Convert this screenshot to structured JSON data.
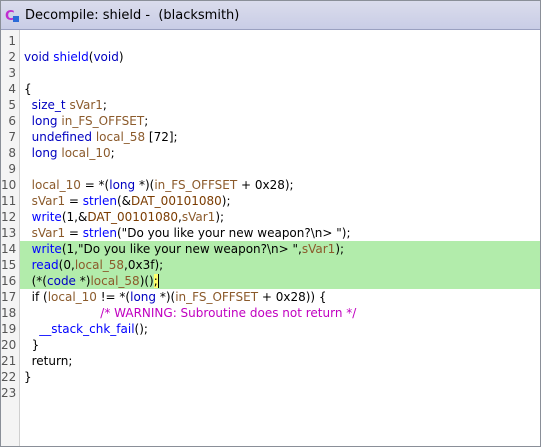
{
  "window": {
    "title": "Decompile: shield -  (blacksmith)",
    "icon": "decompiler-icon",
    "colors": {
      "highlight": "#b2ecab",
      "type": "#0000c0",
      "function": "#0000ff",
      "variable": "#8b5a2b",
      "comment": "#c000c0"
    }
  },
  "code": {
    "lines": [
      {
        "n": "1",
        "hl": false,
        "tokens": []
      },
      {
        "n": "2",
        "hl": false,
        "tokens": [
          {
            "t": "void ",
            "c": "type"
          },
          {
            "t": "shield",
            "c": "func"
          },
          {
            "t": "(",
            "c": "plain"
          },
          {
            "t": "void",
            "c": "type"
          },
          {
            "t": ")",
            "c": "plain"
          }
        ]
      },
      {
        "n": "3",
        "hl": false,
        "tokens": []
      },
      {
        "n": "4",
        "hl": false,
        "tokens": [
          {
            "t": "{",
            "c": "plain"
          }
        ]
      },
      {
        "n": "5",
        "hl": false,
        "tokens": [
          {
            "t": "  ",
            "c": "plain"
          },
          {
            "t": "size_t",
            "c": "type"
          },
          {
            "t": " ",
            "c": "plain"
          },
          {
            "t": "sVar1",
            "c": "var"
          },
          {
            "t": ";",
            "c": "plain"
          }
        ]
      },
      {
        "n": "6",
        "hl": false,
        "tokens": [
          {
            "t": "  ",
            "c": "plain"
          },
          {
            "t": "long",
            "c": "type"
          },
          {
            "t": " ",
            "c": "plain"
          },
          {
            "t": "in_FS_OFFSET",
            "c": "var"
          },
          {
            "t": ";",
            "c": "plain"
          }
        ]
      },
      {
        "n": "7",
        "hl": false,
        "tokens": [
          {
            "t": "  ",
            "c": "plain"
          },
          {
            "t": "undefined",
            "c": "type"
          },
          {
            "t": " ",
            "c": "plain"
          },
          {
            "t": "local_58",
            "c": "var"
          },
          {
            "t": " [72];",
            "c": "plain"
          }
        ]
      },
      {
        "n": "8",
        "hl": false,
        "tokens": [
          {
            "t": "  ",
            "c": "plain"
          },
          {
            "t": "long",
            "c": "type"
          },
          {
            "t": " ",
            "c": "plain"
          },
          {
            "t": "local_10",
            "c": "var"
          },
          {
            "t": ";",
            "c": "plain"
          }
        ]
      },
      {
        "n": "9",
        "hl": false,
        "tokens": []
      },
      {
        "n": "10",
        "hl": false,
        "tokens": [
          {
            "t": "  ",
            "c": "plain"
          },
          {
            "t": "local_10",
            "c": "var"
          },
          {
            "t": " = *(",
            "c": "plain"
          },
          {
            "t": "long",
            "c": "type"
          },
          {
            "t": " *)(",
            "c": "plain"
          },
          {
            "t": "in_FS_OFFSET",
            "c": "var"
          },
          {
            "t": " + 0x28);",
            "c": "plain"
          }
        ]
      },
      {
        "n": "11",
        "hl": false,
        "tokens": [
          {
            "t": "  ",
            "c": "plain"
          },
          {
            "t": "sVar1",
            "c": "var"
          },
          {
            "t": " = ",
            "c": "plain"
          },
          {
            "t": "strlen",
            "c": "func"
          },
          {
            "t": "(&",
            "c": "plain"
          },
          {
            "t": "DAT_00101080",
            "c": "glob"
          },
          {
            "t": ");",
            "c": "plain"
          }
        ]
      },
      {
        "n": "12",
        "hl": false,
        "tokens": [
          {
            "t": "  ",
            "c": "plain"
          },
          {
            "t": "write",
            "c": "func"
          },
          {
            "t": "(1,&",
            "c": "plain"
          },
          {
            "t": "DAT_00101080",
            "c": "glob"
          },
          {
            "t": ",",
            "c": "plain"
          },
          {
            "t": "sVar1",
            "c": "var"
          },
          {
            "t": ");",
            "c": "plain"
          }
        ]
      },
      {
        "n": "13",
        "hl": false,
        "tokens": [
          {
            "t": "  ",
            "c": "plain"
          },
          {
            "t": "sVar1",
            "c": "var"
          },
          {
            "t": " = ",
            "c": "plain"
          },
          {
            "t": "strlen",
            "c": "func"
          },
          {
            "t": "(\"Do you like your new weapon?\\n> \");",
            "c": "plain"
          }
        ]
      },
      {
        "n": "14",
        "hl": true,
        "tokens": [
          {
            "t": "  ",
            "c": "plain"
          },
          {
            "t": "write",
            "c": "func"
          },
          {
            "t": "(1,\"Do you like your new weapon?\\n> \",",
            "c": "plain"
          },
          {
            "t": "sVar1",
            "c": "var"
          },
          {
            "t": ");",
            "c": "plain"
          }
        ]
      },
      {
        "n": "15",
        "hl": true,
        "tokens": [
          {
            "t": "  ",
            "c": "plain"
          },
          {
            "t": "read",
            "c": "func"
          },
          {
            "t": "(0,",
            "c": "plain"
          },
          {
            "t": "local_58",
            "c": "var"
          },
          {
            "t": ",0x3f);",
            "c": "plain"
          }
        ]
      },
      {
        "n": "16",
        "hl": true,
        "tokens": [
          {
            "t": "  (*(",
            "c": "plain"
          },
          {
            "t": "code",
            "c": "type"
          },
          {
            "t": " *)",
            "c": "plain"
          },
          {
            "t": "local_58",
            "c": "var"
          },
          {
            "t": ")()",
            "c": "plain"
          },
          {
            "t": ";",
            "c": "cursor"
          }
        ]
      },
      {
        "n": "17",
        "hl": false,
        "tokens": [
          {
            "t": "  if (",
            "c": "plain"
          },
          {
            "t": "local_10",
            "c": "var"
          },
          {
            "t": " != *(",
            "c": "plain"
          },
          {
            "t": "long",
            "c": "type"
          },
          {
            "t": " *)(",
            "c": "plain"
          },
          {
            "t": "in_FS_OFFSET",
            "c": "var"
          },
          {
            "t": " + 0x28)) {",
            "c": "plain"
          }
        ]
      },
      {
        "n": "18",
        "hl": false,
        "tokens": [
          {
            "t": "                    ",
            "c": "plain"
          },
          {
            "t": "/* WARNING: Subroutine does not return */",
            "c": "comment"
          }
        ]
      },
      {
        "n": "19",
        "hl": false,
        "tokens": [
          {
            "t": "    ",
            "c": "plain"
          },
          {
            "t": "__stack_chk_fail",
            "c": "func"
          },
          {
            "t": "();",
            "c": "plain"
          }
        ]
      },
      {
        "n": "20",
        "hl": false,
        "tokens": [
          {
            "t": "  }",
            "c": "plain"
          }
        ]
      },
      {
        "n": "21",
        "hl": false,
        "tokens": [
          {
            "t": "  return;",
            "c": "plain"
          }
        ]
      },
      {
        "n": "22",
        "hl": false,
        "tokens": [
          {
            "t": "}",
            "c": "plain"
          }
        ]
      },
      {
        "n": "23",
        "hl": false,
        "tokens": []
      }
    ]
  }
}
